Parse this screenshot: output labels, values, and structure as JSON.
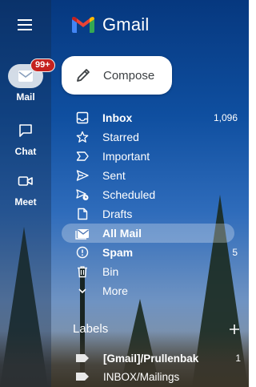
{
  "app": {
    "name": "Gmail"
  },
  "rail": {
    "mail": {
      "label": "Mail",
      "badge": "99+"
    },
    "chat": {
      "label": "Chat"
    },
    "meet": {
      "label": "Meet"
    }
  },
  "compose": {
    "label": "Compose"
  },
  "nav": [
    {
      "label": "Inbox",
      "count": "1,096",
      "icon": "inbox-icon",
      "bold": true
    },
    {
      "label": "Starred",
      "count": "",
      "icon": "star-icon"
    },
    {
      "label": "Important",
      "count": "",
      "icon": "important-icon"
    },
    {
      "label": "Sent",
      "count": "",
      "icon": "send-icon"
    },
    {
      "label": "Scheduled",
      "count": "",
      "icon": "scheduled-icon"
    },
    {
      "label": "Drafts",
      "count": "",
      "icon": "draft-icon"
    },
    {
      "label": "All Mail",
      "count": "",
      "icon": "all-mail-icon",
      "bold": true,
      "selected": true
    },
    {
      "label": "Spam",
      "count": "5",
      "icon": "spam-icon",
      "bold": true
    },
    {
      "label": "Bin",
      "count": "",
      "icon": "bin-icon"
    },
    {
      "label": "More",
      "count": "",
      "icon": "chevron-down-icon"
    }
  ],
  "labels": {
    "title": "Labels",
    "items": [
      {
        "label": "[Gmail]/Prullenbak",
        "count": "1",
        "bold": true
      },
      {
        "label": "INBOX/Mailings",
        "count": ""
      }
    ]
  },
  "colors": {
    "gmail_red": "#ea4335",
    "gmail_blue": "#4285f4",
    "gmail_yellow": "#fbbc04",
    "gmail_green": "#34a853",
    "badge": "#c5221f"
  }
}
